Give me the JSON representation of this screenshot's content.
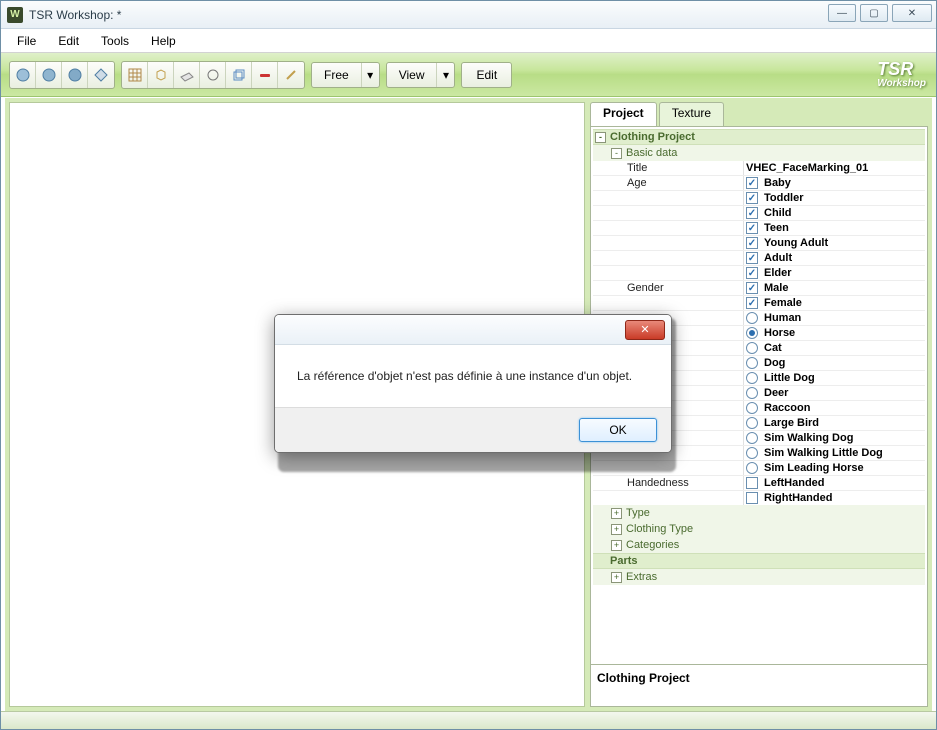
{
  "window": {
    "title": "TSR Workshop: *",
    "controls": {
      "min": "—",
      "max": "▢",
      "close": "✕"
    }
  },
  "menu": [
    "File",
    "Edit",
    "Tools",
    "Help"
  ],
  "toolbar": {
    "free_label": "Free",
    "view_label": "View",
    "edit_label": "Edit",
    "logo_top": "TSR",
    "logo_bottom": "Workshop"
  },
  "tabs": {
    "project": "Project",
    "texture": "Texture"
  },
  "tree": {
    "root": "Clothing Project",
    "basic": "Basic data",
    "title_key": "Title",
    "title_val": "VHEC_FaceMarking_01",
    "age_key": "Age",
    "ages": [
      {
        "label": "Baby",
        "checked": true
      },
      {
        "label": "Toddler",
        "checked": true
      },
      {
        "label": "Child",
        "checked": true
      },
      {
        "label": "Teen",
        "checked": true
      },
      {
        "label": "Young Adult",
        "checked": true
      },
      {
        "label": "Adult",
        "checked": true
      },
      {
        "label": "Elder",
        "checked": true
      }
    ],
    "gender_key": "Gender",
    "genders": [
      {
        "label": "Male",
        "checked": true
      },
      {
        "label": "Female",
        "checked": true
      }
    ],
    "species": [
      {
        "label": "Human",
        "selected": false
      },
      {
        "label": "Horse",
        "selected": true
      },
      {
        "label": "Cat",
        "selected": false
      },
      {
        "label": "Dog",
        "selected": false
      },
      {
        "label": "Little Dog",
        "selected": false
      },
      {
        "label": "Deer",
        "selected": false
      },
      {
        "label": "Raccoon",
        "selected": false
      },
      {
        "label": "Large Bird",
        "selected": false
      },
      {
        "label": "Sim Walking Dog",
        "selected": false
      },
      {
        "label": "Sim Walking Little Dog",
        "selected": false
      },
      {
        "label": "Sim Leading Horse",
        "selected": false
      }
    ],
    "handedness_key": "Handedness",
    "handed": [
      {
        "label": "LeftHanded",
        "checked": false
      },
      {
        "label": "RightHanded",
        "checked": false
      }
    ],
    "sections": [
      "Type",
      "Clothing Type",
      "Categories"
    ],
    "parts": "Parts",
    "extras": "Extras"
  },
  "desc": "Clothing Project",
  "dialog": {
    "message": "La référence d'objet n'est pas définie à une instance d'un objet.",
    "ok": "OK",
    "close": "✕"
  }
}
